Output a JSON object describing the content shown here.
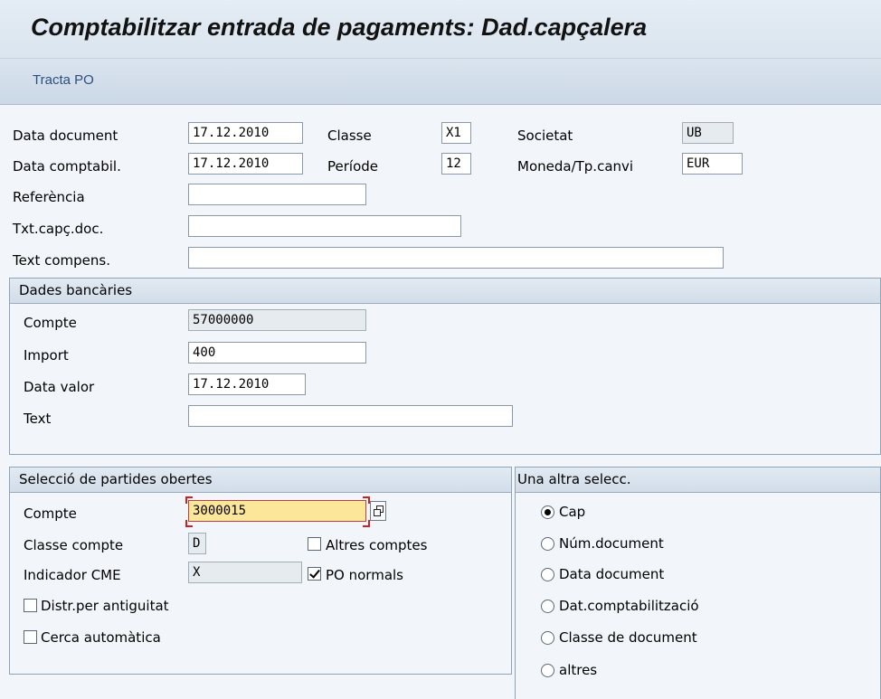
{
  "window": {
    "title": "Comptabilitzar entrada de pagaments: Dad.capçalera"
  },
  "toolbar": {
    "process_open_items": "Tracta PO"
  },
  "header": {
    "doc_date_label": "Data document",
    "doc_date": "17.12.2010",
    "posting_date_label": "Data comptabil.",
    "posting_date": "17.12.2010",
    "class_label": "Classe",
    "class_value": "X1",
    "period_label": "Període",
    "period_value": "12",
    "company_label": "Societat",
    "company_value": "UB",
    "currency_label": "Moneda/Tp.canvi",
    "currency_value": "EUR",
    "reference_label": "Referència",
    "reference_value": "",
    "doc_header_text_label": "Txt.capç.doc.",
    "doc_header_text_value": "",
    "clearing_text_label": "Text compens.",
    "clearing_text_value": ""
  },
  "bank": {
    "title": "Dades bancàries",
    "account_label": "Compte",
    "account_value": "57000000",
    "amount_label": "Import",
    "amount_value": "400",
    "value_date_label": "Data valor",
    "value_date": "17.12.2010",
    "text_label": "Text",
    "text_value": ""
  },
  "open_items": {
    "title": "Selecció de partides obertes",
    "account_label": "Compte",
    "account_value": "3000015",
    "account_type_label": "Classe compte",
    "account_type_value": "D",
    "sgl_label": "Indicador CME",
    "sgl_value": "X",
    "other_accounts_label": "Altres comptes",
    "other_accounts_checked": false,
    "normal_oi_label": "PO normals",
    "normal_oi_checked": true,
    "dist_by_age_label": "Distr.per antiguitat",
    "dist_by_age_checked": false,
    "auto_search_label": "Cerca automàtica",
    "auto_search_checked": false
  },
  "additional_selection": {
    "title": "Una altra selecc.",
    "options": [
      "Cap",
      "Núm.document",
      "Data document",
      "Dat.comptabilització",
      "Classe de document",
      "altres"
    ],
    "selected": "Cap"
  },
  "colors": {
    "focus_field": "#fce699",
    "link_text": "#2b4f80",
    "focus_corner": "#cc2222"
  }
}
